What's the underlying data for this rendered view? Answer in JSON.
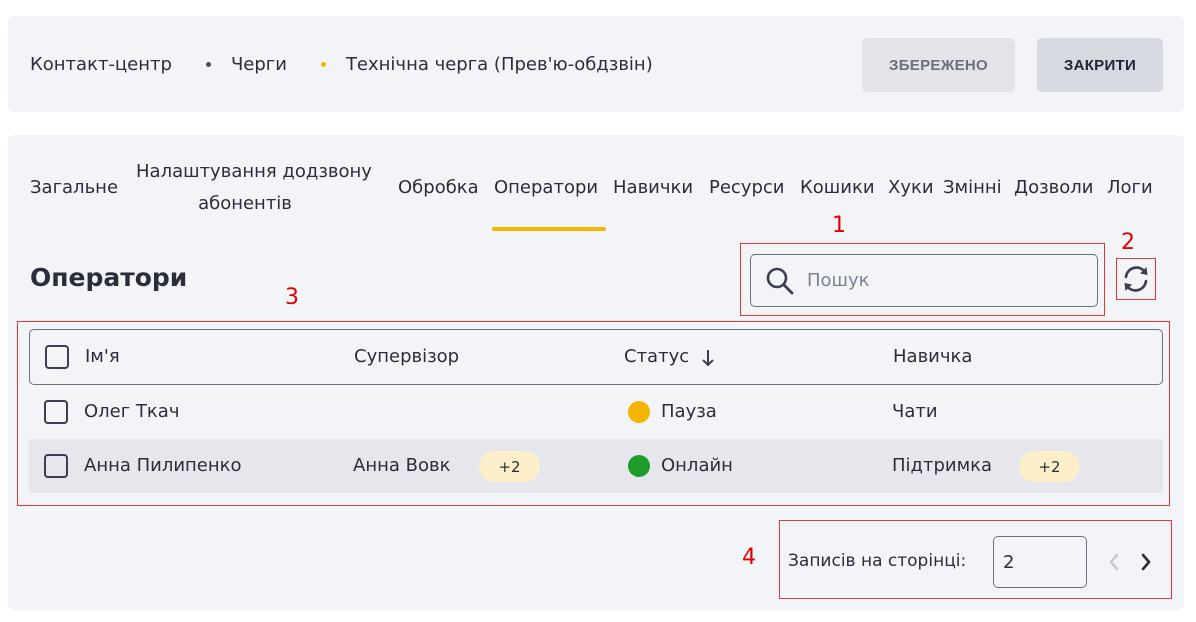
{
  "breadcrumb": {
    "items": [
      "Контакт-центр",
      "Черги",
      "Технічна черга (Прев'ю-обдзвін)"
    ],
    "separator_colors": [
      "#4a4e5e",
      "#f4b400"
    ]
  },
  "actions": {
    "saved_label": "ЗБЕРЕЖЕНО",
    "close_label": "ЗАКРИТИ"
  },
  "tabs": [
    {
      "label": "Загальне"
    },
    {
      "label": "Налаштування додзвону абонентів",
      "line1": "Налаштування додзвону",
      "line2": "абонентів"
    },
    {
      "label": "Обробка"
    },
    {
      "label": "Оператори",
      "active": true
    },
    {
      "label": "Навички"
    },
    {
      "label": "Ресурси"
    },
    {
      "label": "Кошики"
    },
    {
      "label": "Хуки"
    },
    {
      "label": "Змінні"
    },
    {
      "label": "Дозволи"
    },
    {
      "label": "Логи"
    }
  ],
  "section": {
    "title": "Оператори"
  },
  "search": {
    "placeholder": "Пошук",
    "value": ""
  },
  "table": {
    "columns": {
      "name": "Ім'я",
      "supervisor": "Супервізор",
      "status": "Статус",
      "skill": "Навичка"
    },
    "sort": {
      "column": "status",
      "direction": "desc"
    },
    "rows": [
      {
        "name": "Олег Ткач",
        "supervisor": "",
        "supervisor_extra": "",
        "status": "Пауза",
        "status_color": "#f4b400",
        "skill": "Чати",
        "skill_extra": ""
      },
      {
        "name": "Анна Пилипенко",
        "supervisor": "Анна Вовк",
        "supervisor_extra": "+2",
        "status": "Онлайн",
        "status_color": "#1f9b2a",
        "skill": "Підтримка",
        "skill_extra": "+2"
      }
    ]
  },
  "pagination": {
    "label": "Записів на сторінці:",
    "per_page": "2"
  },
  "annotations": [
    "1",
    "2",
    "3",
    "4"
  ],
  "colors": {
    "accent": "#f4b400",
    "annotation": "#e53935"
  }
}
